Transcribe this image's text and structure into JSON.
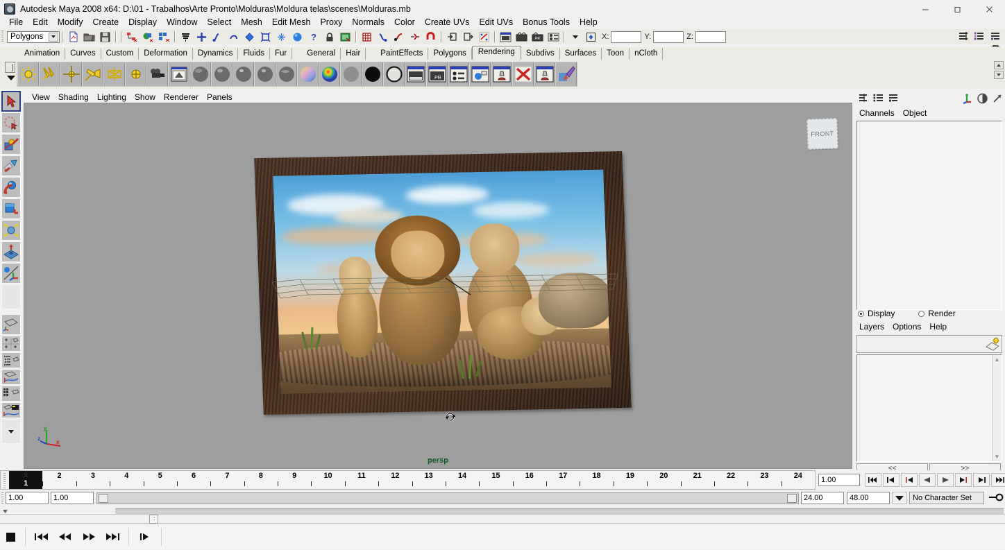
{
  "window": {
    "title": "Autodesk Maya 2008 x64: D:\\01 - Trabalhos\\Arte Pronto\\Molduras\\Moldura telas\\scenes\\Molduras.mb",
    "minimize": "—",
    "maximize": "❐",
    "close": "✕"
  },
  "menubar": {
    "items": [
      {
        "label": "File"
      },
      {
        "label": "Edit"
      },
      {
        "label": "Modify"
      },
      {
        "label": "Create"
      },
      {
        "label": "Display"
      },
      {
        "label": "Window"
      },
      {
        "label": "Select"
      },
      {
        "label": "Mesh"
      },
      {
        "label": "Edit Mesh"
      },
      {
        "label": "Proxy"
      },
      {
        "label": "Normals"
      },
      {
        "label": "Color"
      },
      {
        "label": "Create UVs"
      },
      {
        "label": "Edit UVs"
      },
      {
        "label": "Bonus Tools"
      },
      {
        "label": "Help"
      }
    ]
  },
  "statusbar": {
    "menu_set": "Polygons",
    "coord_labels": {
      "x": "X:",
      "y": "Y:",
      "z": "Z:"
    },
    "coord_values": {
      "x": "",
      "y": "",
      "z": ""
    },
    "icons": [
      "new-scene-icon",
      "open-scene-icon",
      "save-scene-icon",
      "select-by-hierarchy-icon",
      "select-by-object-icon",
      "select-by-component-icon",
      "select-mask-icon",
      "snap-to-grid-icon",
      "snap-to-curve-icon",
      "snap-to-point-icon",
      "snap-to-view-plane-icon",
      "make-live-icon",
      "construction-history-icon",
      "help-icon",
      "lock-icon",
      "render-globals-icon",
      "show-manipulator-icon",
      "input-connections-icon",
      "output-connections-icon",
      "relationship-editor-icon",
      "render-current-frame-icon",
      "ipr-render-icon",
      "render-settings-icon",
      "hypershade-icon",
      "render-view-icon",
      "numeric-input-icon"
    ],
    "right_icons": [
      "attribute-editor-icon",
      "channel-box-icon",
      "tool-settings-icon",
      "trash-icon"
    ]
  },
  "shelf": {
    "tabs": [
      {
        "label": "Animation",
        "active": false
      },
      {
        "label": "Curves",
        "active": false
      },
      {
        "label": "Custom",
        "active": false
      },
      {
        "label": "Deformation",
        "active": false
      },
      {
        "label": "Dynamics",
        "active": false
      },
      {
        "label": "Fluids",
        "active": false
      },
      {
        "label": "Fur",
        "active": false
      },
      {
        "label": "General",
        "active": false
      },
      {
        "label": "Hair",
        "active": false
      },
      {
        "label": "PaintEffects",
        "active": false
      },
      {
        "label": "Polygons",
        "active": false
      },
      {
        "label": "Rendering",
        "active": true
      },
      {
        "label": "Subdivs",
        "active": false
      },
      {
        "label": "Surfaces",
        "active": false
      },
      {
        "label": "Toon",
        "active": false
      },
      {
        "label": "nCloth",
        "active": false
      }
    ],
    "icons": [
      "ambient-light-icon",
      "directional-light-icon",
      "point-light-icon",
      "spot-light-icon",
      "area-light-icon",
      "volume-light-icon",
      "camera-icon",
      "image-plane-icon",
      "lambert-material-icon",
      "blinn-material-icon",
      "phong-material-icon",
      "phong-e-material-icon",
      "anisotropic-material-icon",
      "layered-shader-icon",
      "ramp-shader-icon",
      "surface-shader-icon",
      "use-background-icon",
      "shading-map-icon",
      "render-current-frame-icon",
      "ipr-render-icon",
      "batch-render-icon",
      "render-settings-icon",
      "create-render-node-icon",
      "delete-render-node-icon",
      "edit-render-node-icon",
      "paint-effects-icon"
    ]
  },
  "toolbox": {
    "tools": [
      {
        "name": "select-tool",
        "selected": true
      },
      {
        "name": "lasso-select-tool",
        "selected": false
      },
      {
        "name": "paint-select-tool",
        "selected": false
      },
      {
        "name": "move-tool",
        "selected": false
      },
      {
        "name": "rotate-tool",
        "selected": false
      },
      {
        "name": "scale-tool",
        "selected": false
      },
      {
        "name": "universal-manipulator-tool",
        "selected": false
      },
      {
        "name": "soft-modification-tool",
        "selected": false
      },
      {
        "name": "show-manipulator-tool",
        "selected": false
      },
      {
        "name": "last-tool-used",
        "selected": false
      }
    ],
    "layouts": [
      {
        "name": "single-perspective-layout"
      },
      {
        "name": "four-view-layout"
      },
      {
        "name": "outliner-persp-layout"
      },
      {
        "name": "persp-graph-layout"
      },
      {
        "name": "hypershade-persp-layout"
      },
      {
        "name": "persp-render-layout"
      },
      {
        "name": "layout-menu-icon"
      }
    ]
  },
  "viewport": {
    "menus": [
      {
        "label": "View"
      },
      {
        "label": "Shading"
      },
      {
        "label": "Lighting"
      },
      {
        "label": "Show"
      },
      {
        "label": "Renderer"
      },
      {
        "label": "Panels"
      }
    ],
    "camera_label": "persp",
    "viewcube_label": "FRONT",
    "axis": {
      "x": "x",
      "y": "y",
      "z": "z"
    },
    "background_color": "#9e9e9e",
    "scene_object": "framed-lion-picture",
    "frame_color": "#3a2418"
  },
  "channelbox": {
    "tabs": [
      {
        "label": "Channels"
      },
      {
        "label": "Object"
      }
    ],
    "toolbar_icons": [
      "channel-box-icon",
      "layer-editor-icon",
      "attribute-list-icon"
    ],
    "right_icons": [
      "show-manipulator-icon",
      "attribute-editor-icon",
      "tool-settings-icon"
    ]
  },
  "layereditor": {
    "display_label": "Display",
    "render_label": "Render",
    "display_selected": true,
    "menus": [
      {
        "label": "Layers"
      },
      {
        "label": "Options"
      },
      {
        "label": "Help"
      }
    ],
    "new_layer_icon": "new-layer-icon",
    "nav_prev": "<<",
    "nav_next": ">>"
  },
  "timeslider": {
    "current_frame_marker": "1",
    "ticks": [
      "1",
      "2",
      "3",
      "4",
      "5",
      "6",
      "7",
      "8",
      "9",
      "10",
      "11",
      "12",
      "13",
      "14",
      "15",
      "16",
      "17",
      "18",
      "19",
      "20",
      "21",
      "22",
      "23",
      "24"
    ],
    "current_frame_field": "1.00",
    "playback_buttons": [
      {
        "name": "go-to-start-button",
        "glyph": "start"
      },
      {
        "name": "step-back-keyframe-button",
        "glyph": "prevkey"
      },
      {
        "name": "step-back-frame-button",
        "glyph": "prevframe"
      },
      {
        "name": "play-backwards-button",
        "glyph": "playback"
      },
      {
        "name": "play-forwards-button",
        "glyph": "playfwd"
      },
      {
        "name": "step-forward-frame-button",
        "glyph": "nextframe"
      },
      {
        "name": "step-forward-keyframe-button",
        "glyph": "nextkey"
      },
      {
        "name": "go-to-end-button",
        "glyph": "end"
      }
    ]
  },
  "rangeslider": {
    "anim_start": "1.00",
    "range_start": "1.00",
    "range_end": "24.00",
    "anim_end": "48.00",
    "playback_range_label": "24.00",
    "character_set": "No Character Set",
    "auto_key_icon": "auto-keyframe-icon",
    "anim_prefs_icon": "animation-preferences-icon"
  },
  "taskbar": {
    "buttons": [
      {
        "name": "stop-button",
        "glyph": "stop"
      },
      {
        "name": "skip-to-start-button",
        "glyph": "skipstart"
      },
      {
        "name": "rewind-button",
        "glyph": "rewind"
      },
      {
        "name": "fast-forward-button",
        "glyph": "forward"
      },
      {
        "name": "skip-to-end-button",
        "glyph": "skipend"
      },
      {
        "name": "step-button",
        "glyph": "step"
      }
    ]
  }
}
